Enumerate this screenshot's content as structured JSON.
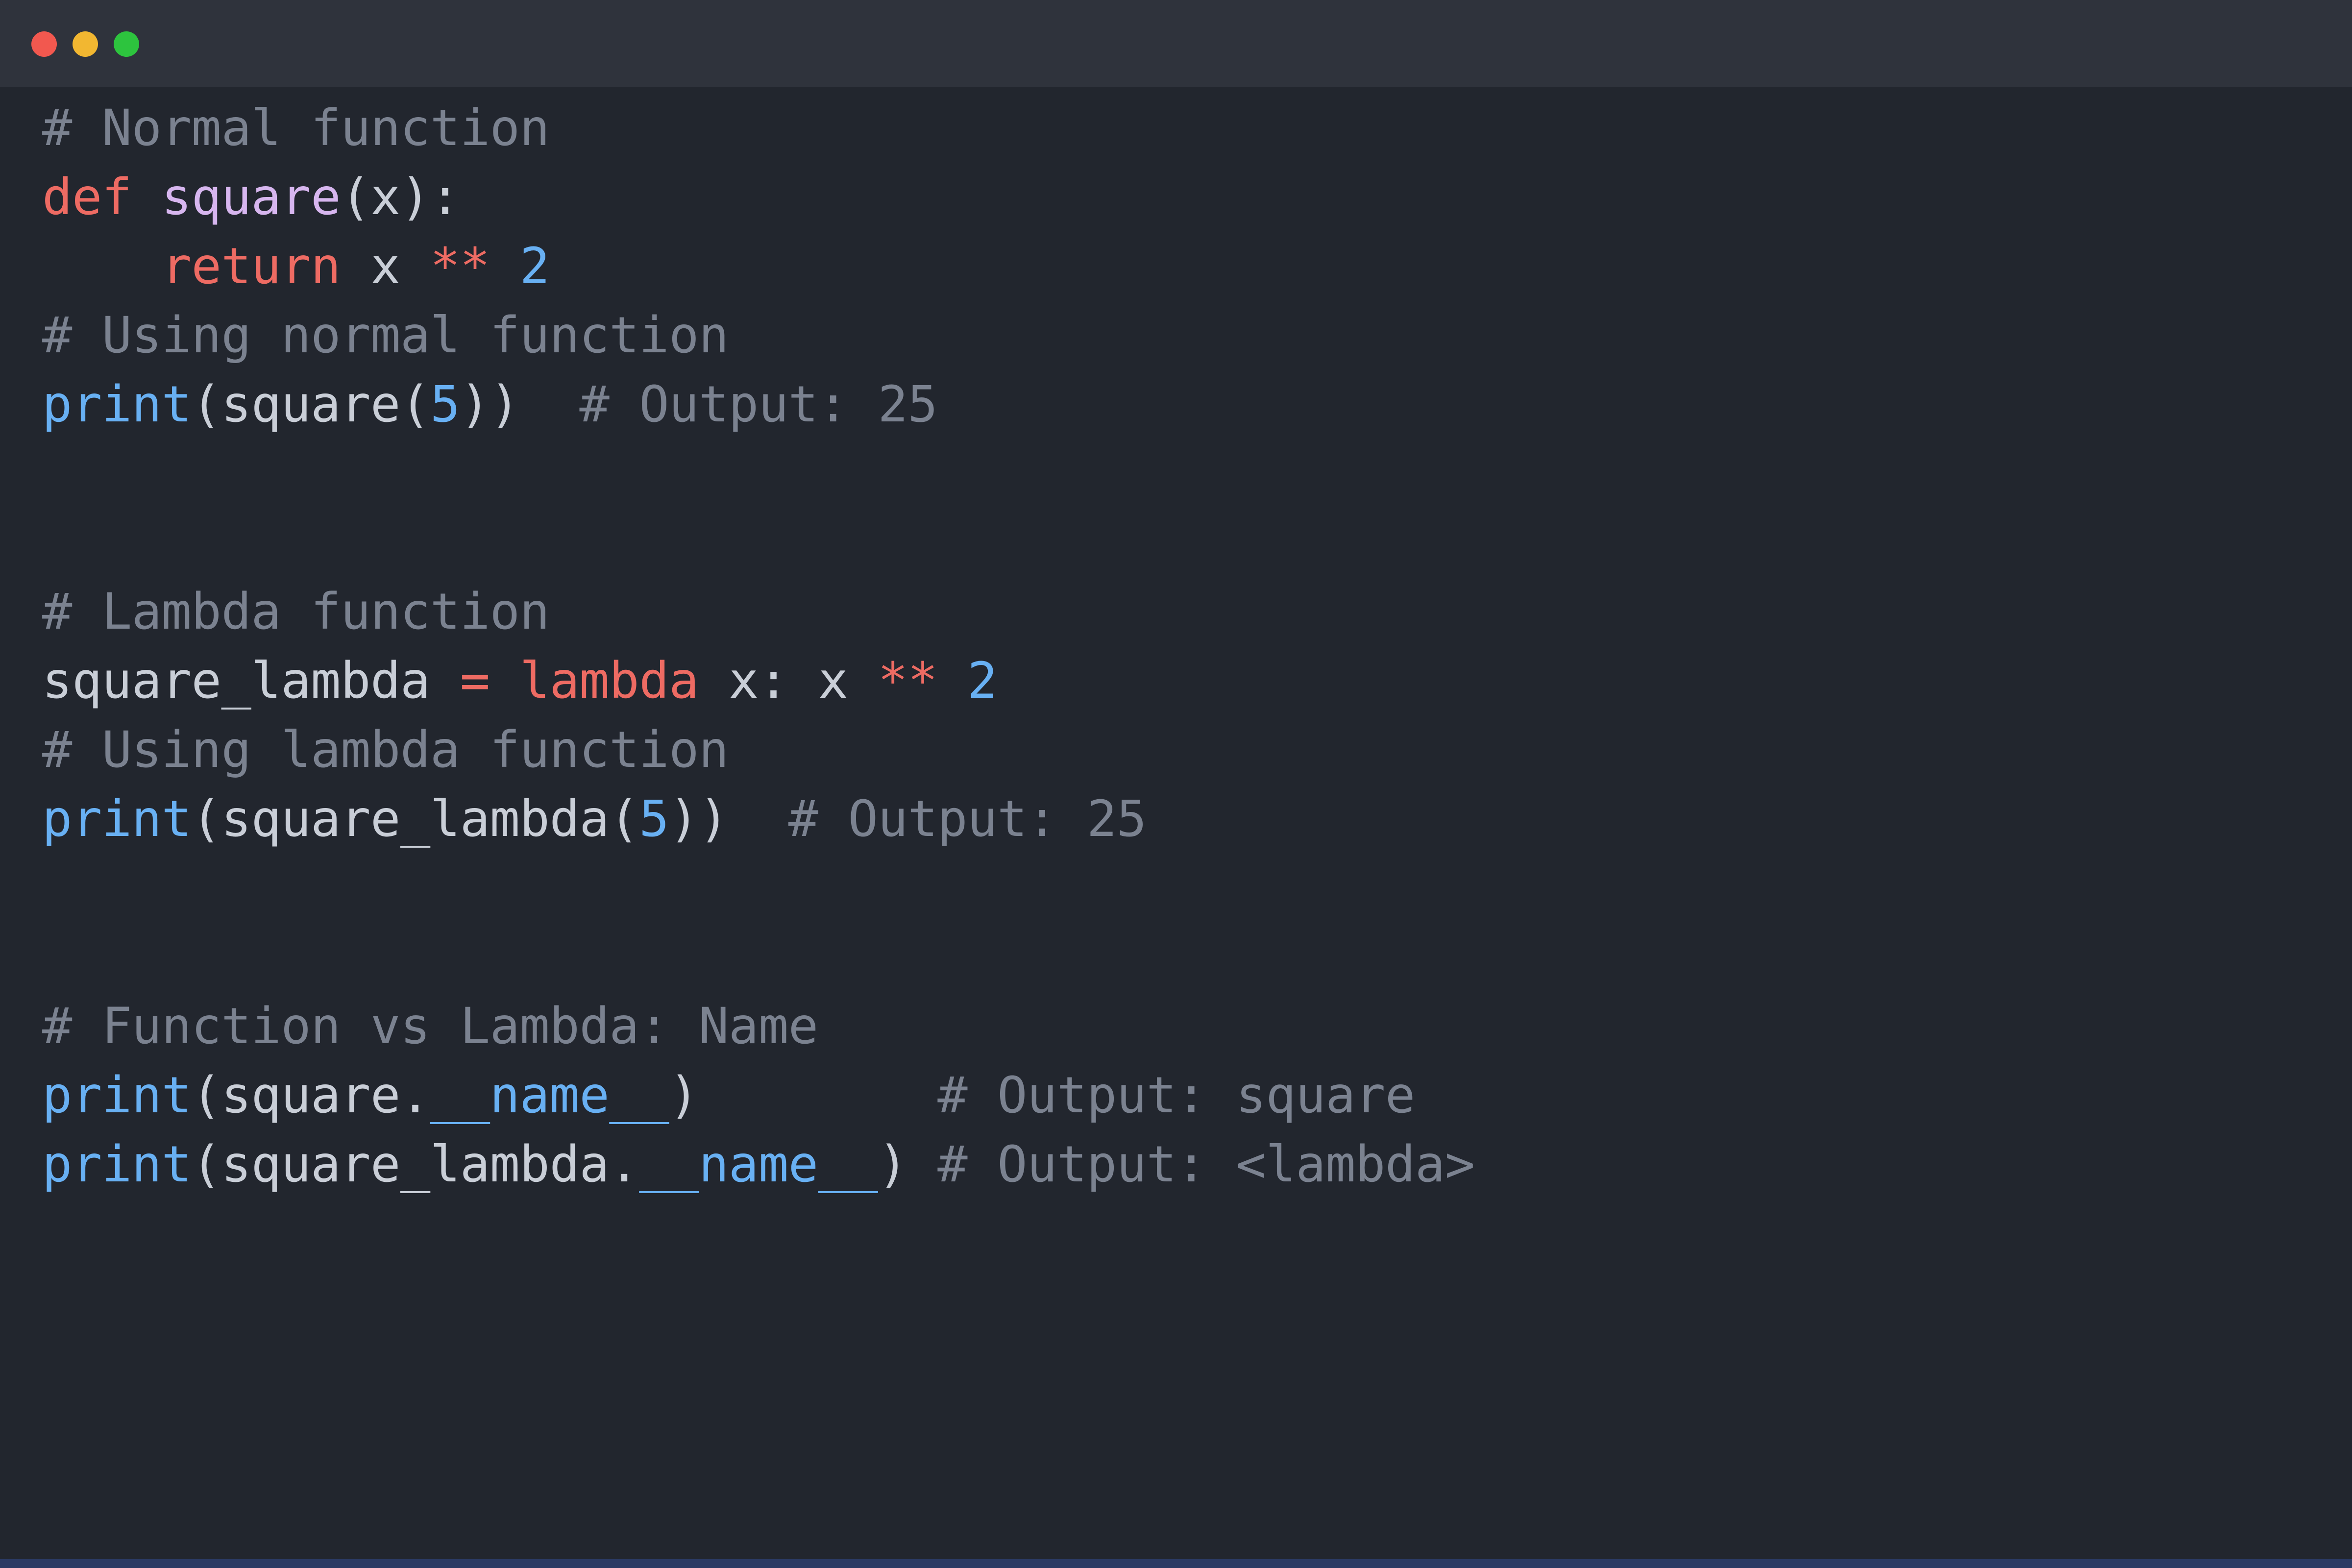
{
  "window": {
    "controls": {
      "close_color": "#f2584f",
      "minimize_color": "#f2b731",
      "maximize_color": "#2dc43e"
    }
  },
  "colors": {
    "background": "#22262e",
    "titlebar": "#2f333c",
    "comment": "#7b8290",
    "keyword": "#ee6b63",
    "function_name": "#d7b6ef",
    "builtin": "#68b0f3",
    "number": "#68b0f3",
    "text": "#c9ced7"
  },
  "code": {
    "language": "python",
    "lines": [
      [
        {
          "t": "comment",
          "v": "# Normal function"
        }
      ],
      [
        {
          "t": "keyword",
          "v": "def"
        },
        {
          "t": "plain",
          "v": " "
        },
        {
          "t": "func",
          "v": "square"
        },
        {
          "t": "plain",
          "v": "(x):"
        }
      ],
      [
        {
          "t": "plain",
          "v": "    "
        },
        {
          "t": "keyword",
          "v": "return"
        },
        {
          "t": "plain",
          "v": " x "
        },
        {
          "t": "operator",
          "v": "**"
        },
        {
          "t": "plain",
          "v": " "
        },
        {
          "t": "number",
          "v": "2"
        }
      ],
      [
        {
          "t": "comment",
          "v": "# Using normal function"
        }
      ],
      [
        {
          "t": "builtin",
          "v": "print"
        },
        {
          "t": "plain",
          "v": "(square("
        },
        {
          "t": "number",
          "v": "5"
        },
        {
          "t": "plain",
          "v": "))  "
        },
        {
          "t": "comment",
          "v": "# Output: 25"
        }
      ],
      [],
      [],
      [
        {
          "t": "comment",
          "v": "# Lambda function"
        }
      ],
      [
        {
          "t": "plain",
          "v": "square_lambda "
        },
        {
          "t": "operator",
          "v": "="
        },
        {
          "t": "plain",
          "v": " "
        },
        {
          "t": "keyword",
          "v": "lambda"
        },
        {
          "t": "plain",
          "v": " x: x "
        },
        {
          "t": "operator",
          "v": "**"
        },
        {
          "t": "plain",
          "v": " "
        },
        {
          "t": "number",
          "v": "2"
        }
      ],
      [
        {
          "t": "comment",
          "v": "# Using lambda function"
        }
      ],
      [
        {
          "t": "builtin",
          "v": "print"
        },
        {
          "t": "plain",
          "v": "(square_lambda("
        },
        {
          "t": "number",
          "v": "5"
        },
        {
          "t": "plain",
          "v": "))  "
        },
        {
          "t": "comment",
          "v": "# Output: 25"
        }
      ],
      [],
      [],
      [
        {
          "t": "comment",
          "v": "# Function vs Lambda: Name"
        }
      ],
      [
        {
          "t": "builtin",
          "v": "print"
        },
        {
          "t": "plain",
          "v": "(square."
        },
        {
          "t": "dunder",
          "v": "__name__"
        },
        {
          "t": "plain",
          "v": ")        "
        },
        {
          "t": "comment",
          "v": "# Output: square"
        }
      ],
      [
        {
          "t": "builtin",
          "v": "print"
        },
        {
          "t": "plain",
          "v": "(square_lambda."
        },
        {
          "t": "dunder",
          "v": "__name__"
        },
        {
          "t": "plain",
          "v": ") "
        },
        {
          "t": "comment",
          "v": "# Output: <lambda>"
        }
      ]
    ]
  }
}
